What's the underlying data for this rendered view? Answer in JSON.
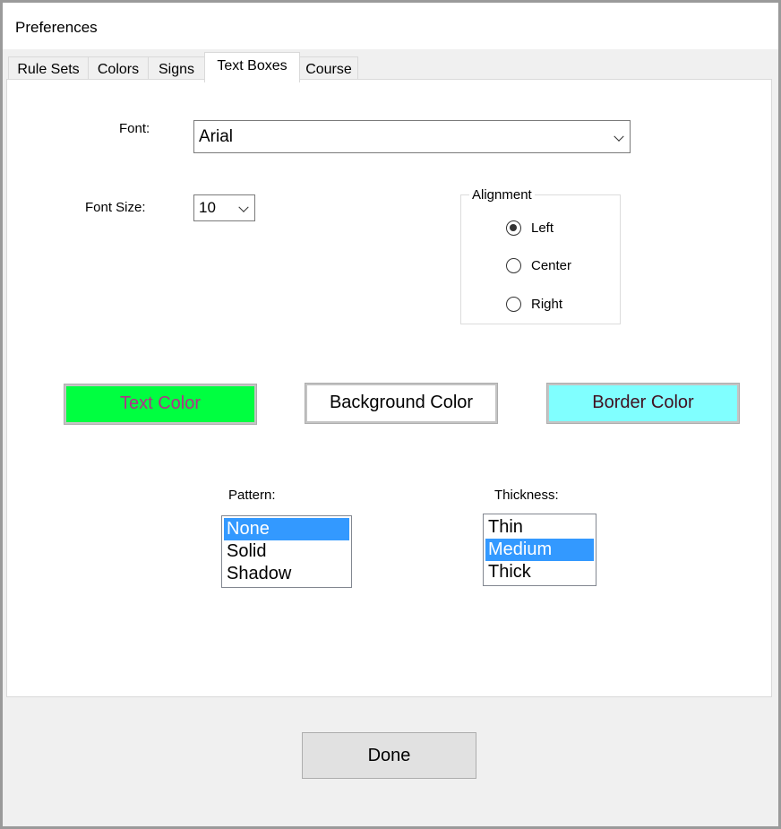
{
  "window": {
    "title": "Preferences"
  },
  "tabs": [
    {
      "label": "Rule Sets"
    },
    {
      "label": "Colors"
    },
    {
      "label": "Signs"
    },
    {
      "label": "Text Boxes",
      "active": true
    },
    {
      "label": "Course"
    }
  ],
  "font": {
    "label": "Font:",
    "value": "Arial"
  },
  "font_size": {
    "label": "Font Size:",
    "value": "10"
  },
  "alignment": {
    "label": "Alignment",
    "options": [
      {
        "label": "Left",
        "selected": true
      },
      {
        "label": "Center"
      },
      {
        "label": "Right"
      }
    ]
  },
  "color_buttons": {
    "text_color": {
      "label": "Text Color",
      "bg": "#00ff40",
      "fg": "#b0308a"
    },
    "background_color": {
      "label": "Background Color",
      "bg": "#ffffff",
      "fg": "#000000"
    },
    "border_color": {
      "label": "Border Color",
      "bg": "#80ffff",
      "fg": "#401020"
    }
  },
  "pattern": {
    "label": "Pattern:",
    "items": [
      "None",
      "Solid",
      "Shadow"
    ],
    "selected": "None"
  },
  "thickness": {
    "label": "Thickness:",
    "items": [
      "Thin",
      "Medium",
      "Thick"
    ],
    "selected": "Medium"
  },
  "done_label": "Done"
}
